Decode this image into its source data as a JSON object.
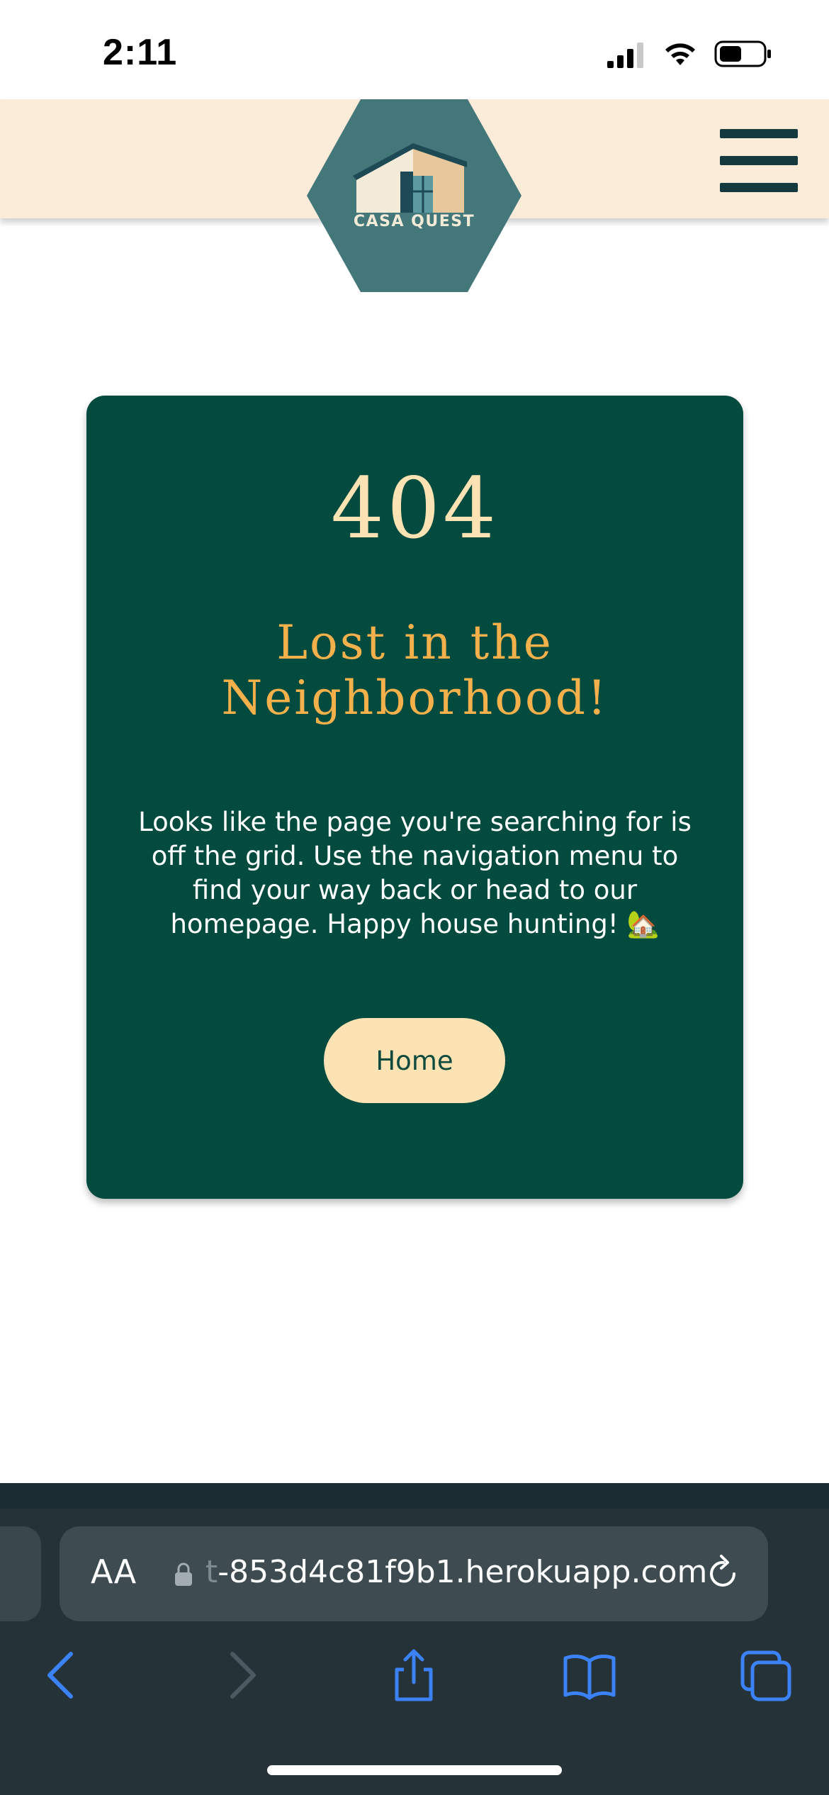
{
  "status_bar": {
    "time": "2:11"
  },
  "header": {
    "logo_text": "CASA QUEST",
    "menu_icon": "hamburger-menu-icon"
  },
  "error": {
    "code": "404",
    "headline": "Lost in the Neighborhood!",
    "message": "Looks like the page you're searching for is off the grid. Use the navigation menu to find your way back or head to our homepage. Happy house hunting! 🏡",
    "home_button": "Home"
  },
  "browser": {
    "aa_label": "AA",
    "url_faded": "t",
    "url": "-853d4c81f9b1.herokuapp.com",
    "icons": [
      "lock-icon",
      "reload-icon",
      "back-icon",
      "forward-icon",
      "share-icon",
      "bookmarks-icon",
      "tabs-icon"
    ]
  },
  "colors": {
    "header_bg": "#fbebd9",
    "logo_bg": "#43777a",
    "card_bg": "#024b3e",
    "code_color": "#fde3b3",
    "headline_color": "#f4b04a",
    "button_bg": "#fde3b3",
    "browser_accent": "#3b82f6"
  }
}
